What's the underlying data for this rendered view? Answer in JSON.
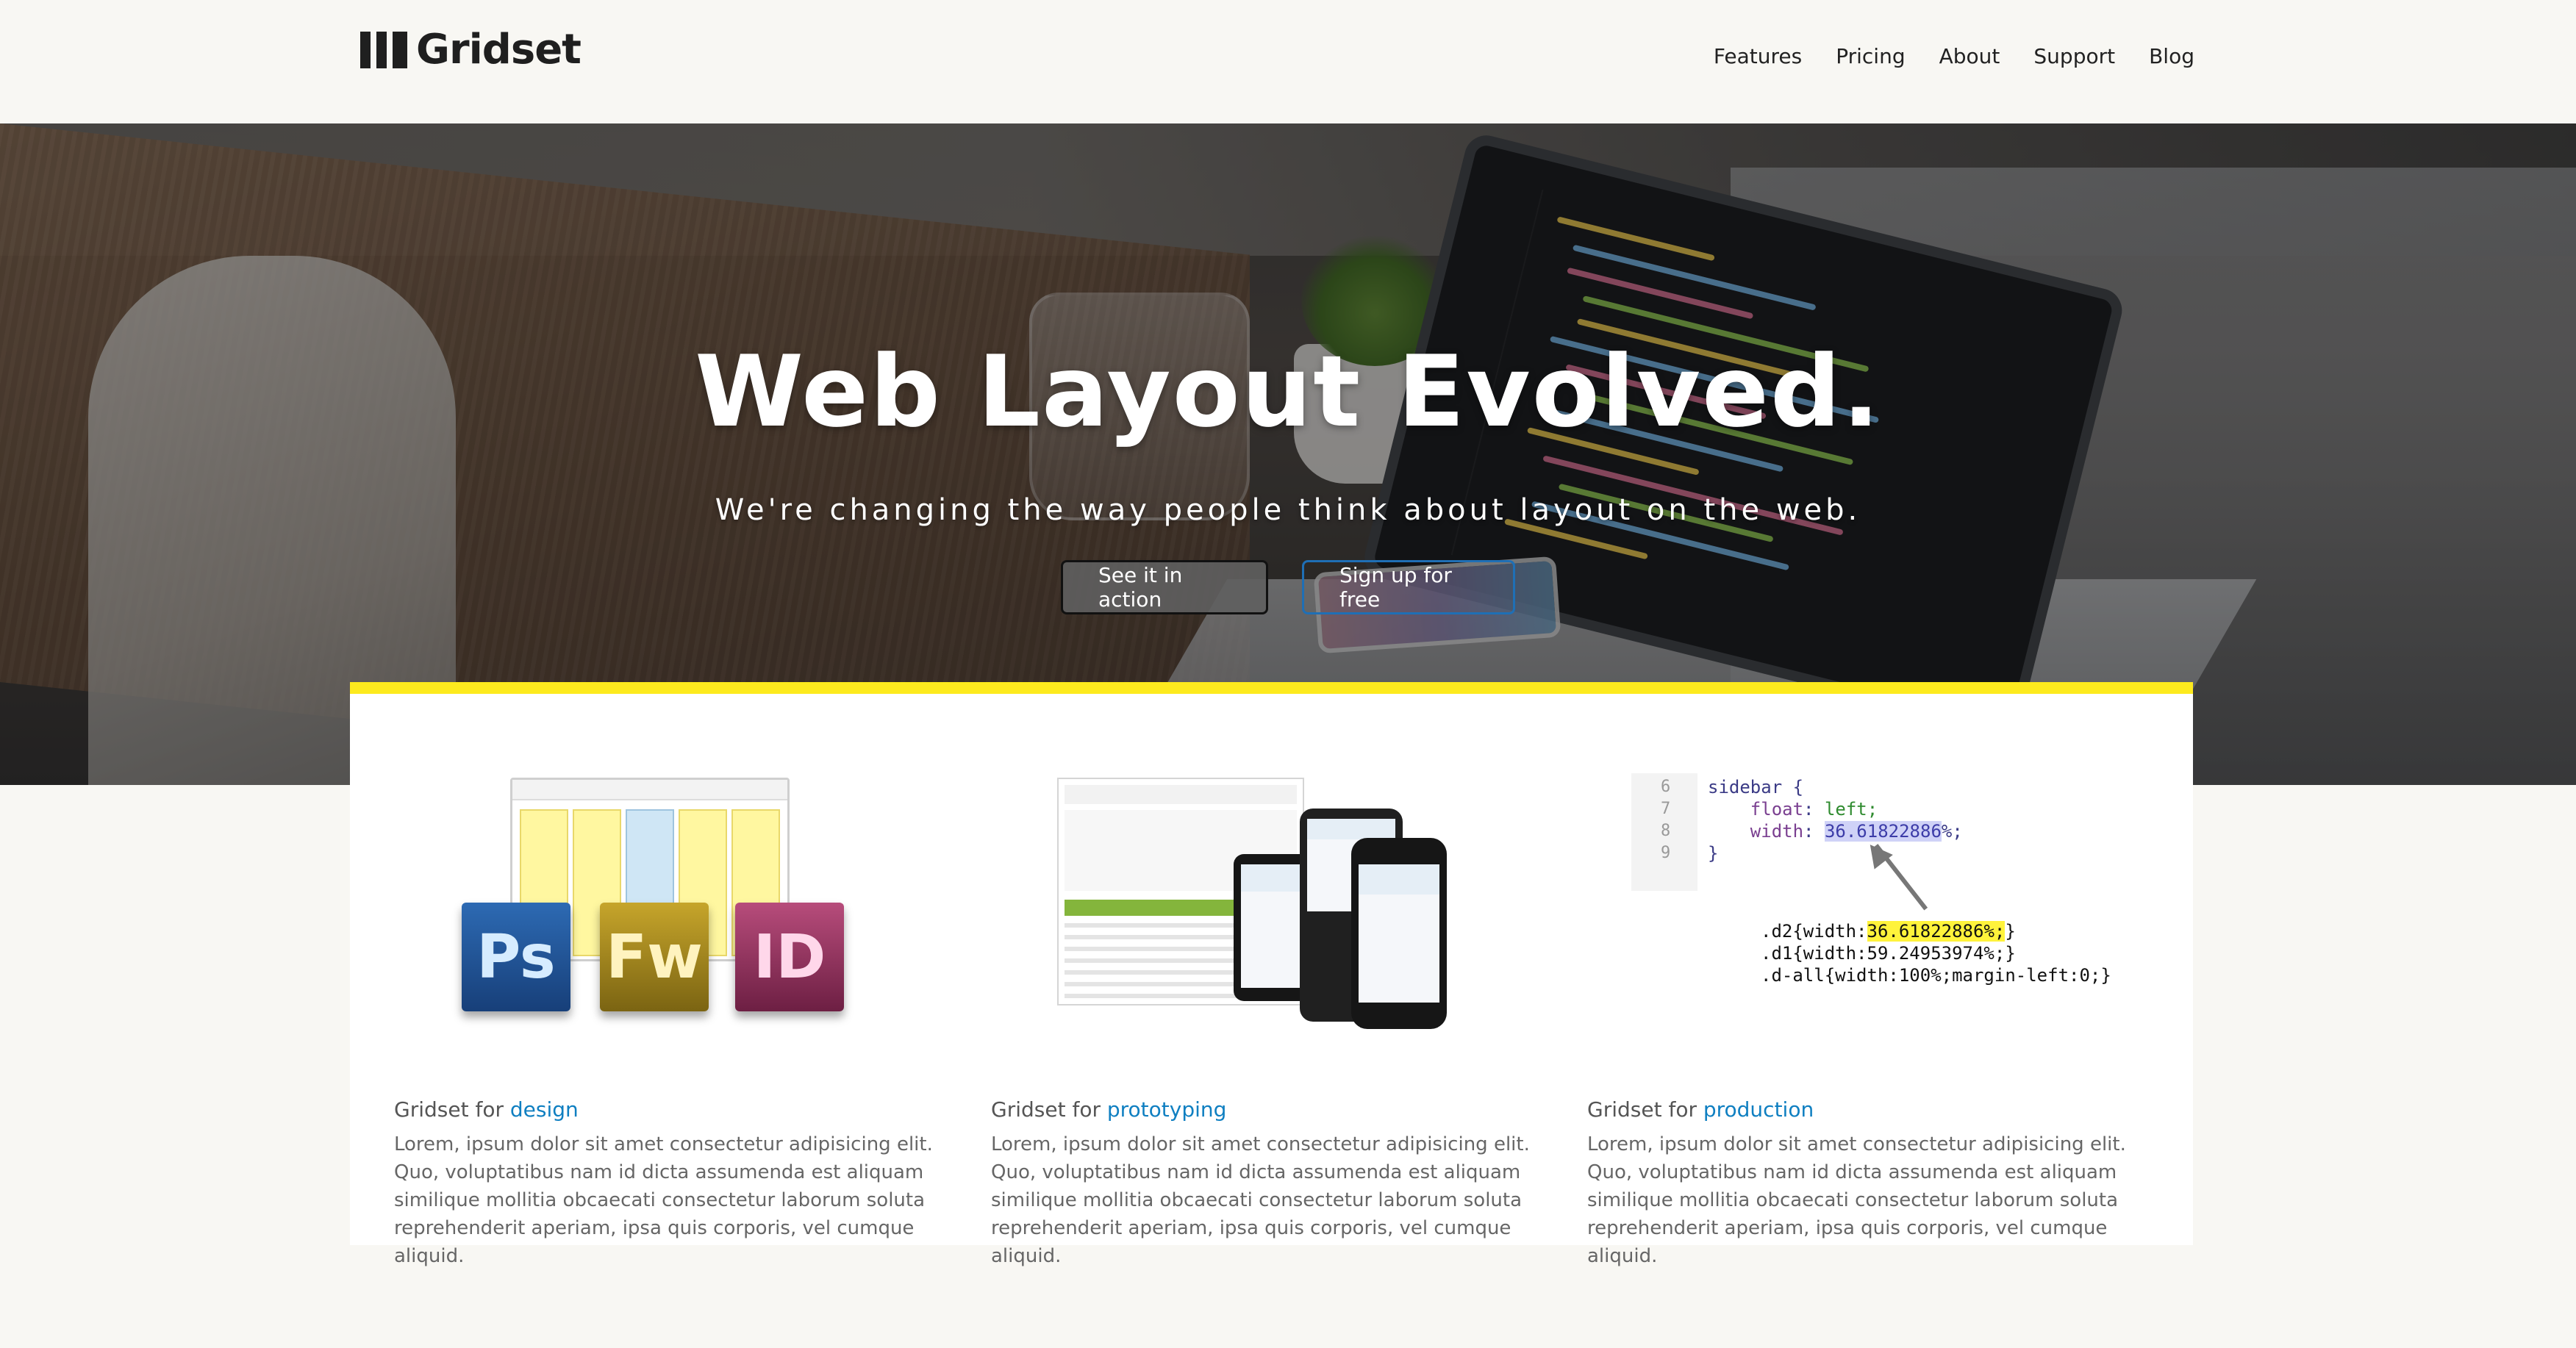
{
  "header": {
    "brand": "Gridset",
    "nav": [
      "Features",
      "Pricing",
      "About",
      "Support",
      "Blog"
    ]
  },
  "hero": {
    "title": "Web Layout Evolved.",
    "subtitle": "We're changing the way people think about layout on the web.",
    "primary_button": "See it in action",
    "secondary_button": "Sign up for free"
  },
  "features": [
    {
      "prefix": "Gridset for ",
      "highlight": "design",
      "body": "Lorem, ipsum dolor sit amet consectetur adipisicing elit. Quo, voluptatibus nam id dicta assumenda est aliquam similique mollitia obcaecati consectetur laborum soluta reprehenderit aperiam, ipsa quis corporis, vel cumque aliquid.",
      "icons": [
        "Ps",
        "Fw",
        "ID"
      ]
    },
    {
      "prefix": "Gridset for ",
      "highlight": "prototyping",
      "body": "Lorem, ipsum dolor sit amet consectetur adipisicing elit. Quo, voluptatibus nam id dicta assumenda est aliquam similique mollitia obcaecati consectetur laborum soluta reprehenderit aperiam, ipsa quis corporis, vel cumque aliquid."
    },
    {
      "prefix": "Gridset for ",
      "highlight": "production",
      "body": "Lorem, ipsum dolor sit amet consectetur adipisicing elit. Quo, voluptatibus nam id dicta assumenda est aliquam similique mollitia obcaecati consectetur laborum soluta reprehenderit aperiam, ipsa quis corporis, vel cumque aliquid.",
      "code": {
        "line_numbers": [
          "6",
          "7",
          "8",
          "9"
        ],
        "selector": "sidebar {",
        "prop1": "float",
        "val1": "left;",
        "prop2": "width",
        "val2": "36.61822886",
        "val2_suffix": "%;",
        "close": "}",
        "rule1_prefix": ".d2{width:",
        "rule1_value": "36.61822886%;",
        "rule1_suffix": "}",
        "rule2": ".d1{width:59.24953974%;}",
        "rule3": ".d-all{width:100%;margin-left:0;}"
      }
    }
  ],
  "colors": {
    "accent_yellow": "#fdea1e",
    "link_blue": "#0f7fc1",
    "page_bg": "#f8f7f3"
  }
}
